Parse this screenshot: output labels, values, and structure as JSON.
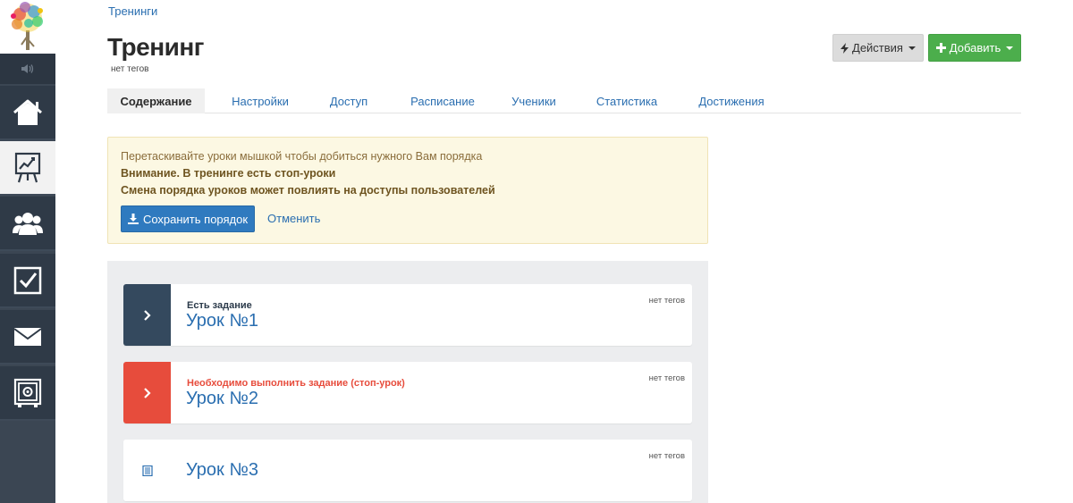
{
  "breadcrumb": "Тренинги",
  "page": {
    "title": "Тренинг",
    "tags": "нет тегов"
  },
  "header_buttons": {
    "actions_label": "Действия",
    "add_label": "Добавить"
  },
  "tabs": [
    {
      "label": "Содержание",
      "active": true
    },
    {
      "label": "Настройки"
    },
    {
      "label": "Доступ"
    },
    {
      "label": "Расписание"
    },
    {
      "label": "Ученики"
    },
    {
      "label": "Статистика"
    },
    {
      "label": "Достижения"
    }
  ],
  "notice": {
    "line1": "Перетаскивайте уроки мышкой чтобы добиться нужного Вам порядка",
    "line2": "Внимание. В тренинге есть стоп-уроки",
    "line3": "Смена порядка уроков может повлиять на доступы пользователей",
    "save_label": "Сохранить порядок",
    "cancel_label": "Отменить"
  },
  "lessons": [
    {
      "status": "Есть задание",
      "title": "Урок №1",
      "tags": "нет тегов",
      "marker_color": "#34495e"
    },
    {
      "status": "Необходимо выполнить задание (стоп-урок)",
      "title": "Урок №2",
      "tags": "нет тегов",
      "marker_color": "#e74c3c"
    },
    {
      "status": "",
      "title": "Урок №3",
      "tags": "нет тегов",
      "marker_color": "#ffffff"
    }
  ],
  "colors": {
    "sidebar": "#2f3a47",
    "primary": "#2f7abf",
    "success": "#4cae4c",
    "danger": "#e74c3c"
  },
  "sidebar_icons": [
    "speaker-icon",
    "home-icon",
    "chart-icon",
    "users-icon",
    "checkbox-icon",
    "mail-icon",
    "safe-icon"
  ]
}
